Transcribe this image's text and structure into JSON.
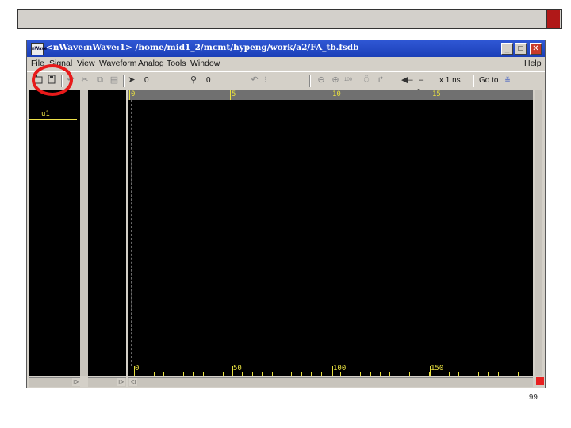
{
  "window": {
    "app_icon_label": "nWave",
    "title": "<nWave:nWave:1> /home/mid1_2/mcmt/hypeng/work/a2/FA_tb.fsdb",
    "buttons": {
      "minimize": "_",
      "maximize": "□",
      "close": "✕"
    }
  },
  "menu": {
    "items": [
      "File",
      "Signal",
      "View",
      "Waveform",
      "Analog",
      "Tools",
      "Window"
    ],
    "help": "Help"
  },
  "toolbar": {
    "icons": [
      "open-icon",
      "save-icon",
      "undo-icon",
      "cut-icon",
      "copy-icon",
      "paste-icon",
      "pointer-icon",
      "marker-icon",
      "zoom-in-icon",
      "zoom-fit-icon",
      "search-icon",
      "back-icon",
      "forward-icon"
    ],
    "cursor_time": "0",
    "marker_time": "0",
    "zoom_unit": "x 1 ns",
    "goto_label": "Go to"
  },
  "signals": [
    {
      "name": "u1"
    }
  ],
  "ruler": {
    "top_labels": [
      "0",
      "5",
      "10",
      "15"
    ],
    "bottom_labels": [
      "0",
      "50",
      "100",
      "150"
    ]
  },
  "slide": {
    "page_number": "99"
  },
  "colors": {
    "wave_bg": "#000000",
    "signal": "#e8e040",
    "titlebar": "#1f48c4",
    "highlight": "#e81a1a"
  }
}
